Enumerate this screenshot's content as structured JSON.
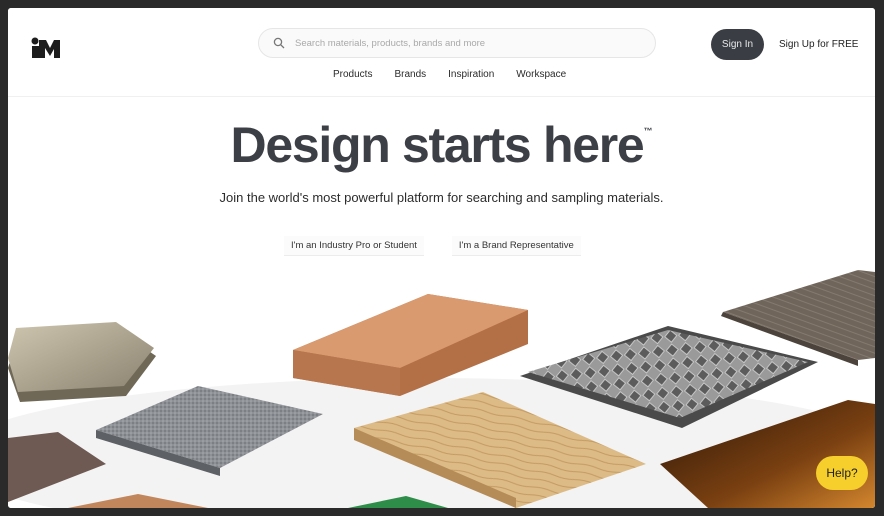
{
  "header": {
    "logo": "materialbank-logo",
    "search": {
      "placeholder": "Search materials, products, brands and more",
      "icon": "search-icon"
    },
    "nav": [
      "Products",
      "Brands",
      "Inspiration",
      "Workspace"
    ],
    "sign_in": "Sign In",
    "sign_up": "Sign Up for FREE"
  },
  "hero": {
    "title": "Design starts here",
    "trademark": "™",
    "subtitle": "Join the world's most powerful platform for searching and sampling materials.",
    "cta_pro": "I'm an Industry Pro or Student",
    "cta_brand": "I'm a Brand Representative"
  },
  "help": {
    "label": "Help?",
    "color": "#f6cf2c"
  },
  "colors": {
    "title": "#3c3f45",
    "sign_in_bg": "#3a3d44"
  }
}
